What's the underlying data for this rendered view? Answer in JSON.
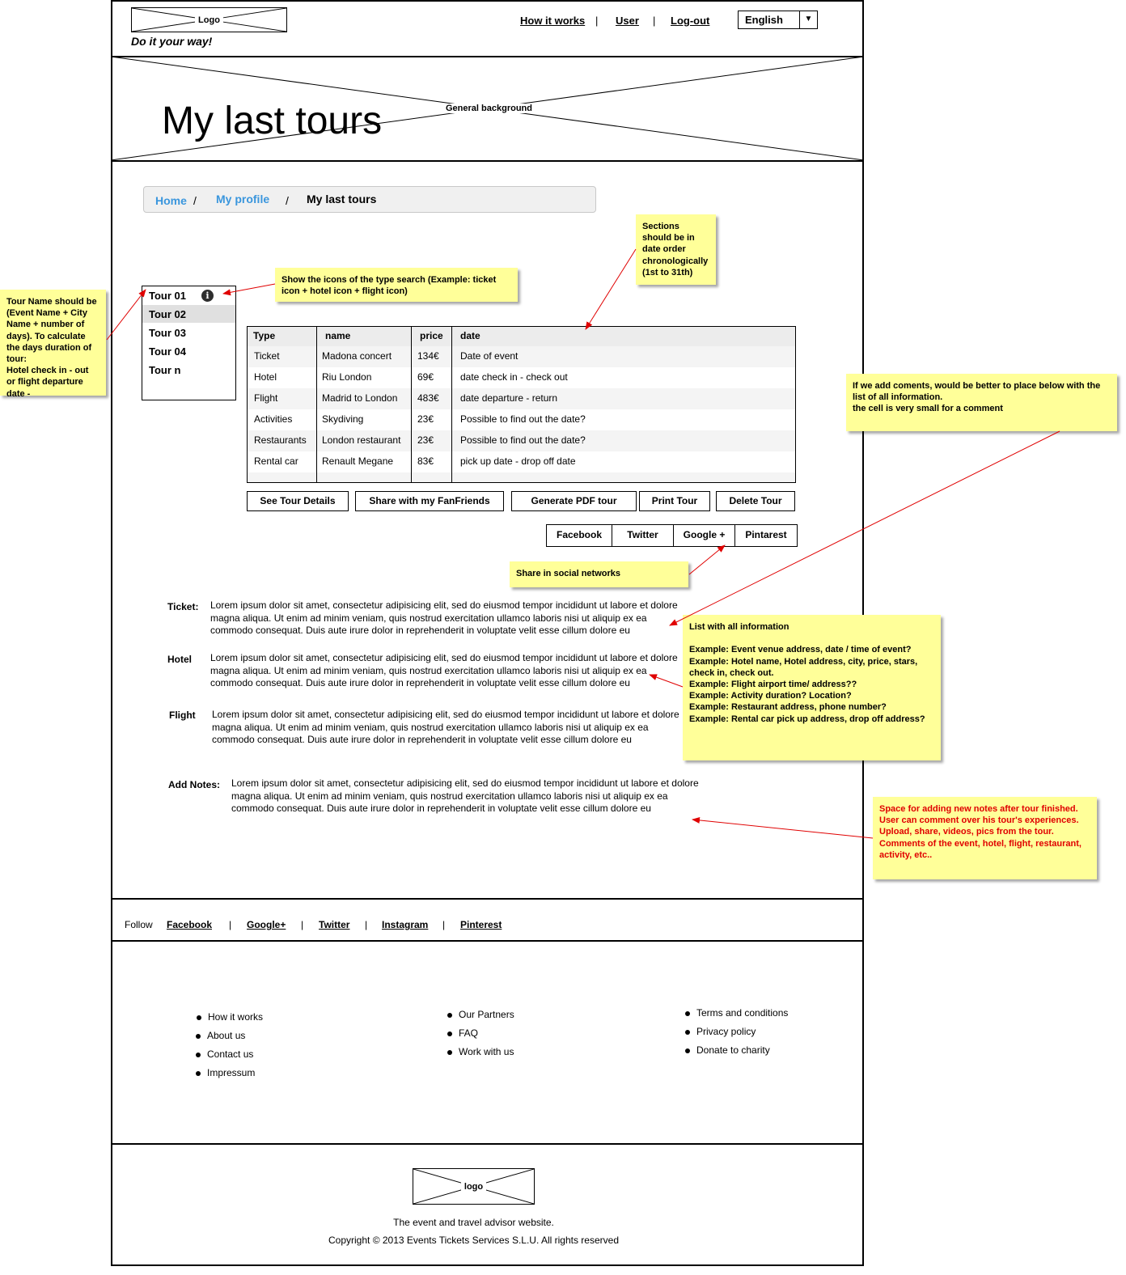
{
  "header": {
    "logo_label": "Logo",
    "tagline": "Do it your way!",
    "nav": [
      "How it works",
      "User",
      "Log-out"
    ],
    "nav_sep": "|",
    "language": "English"
  },
  "hero": {
    "title": "My last tours",
    "background_label": "General background"
  },
  "breadcrumb": {
    "home": "Home",
    "profile": "My profile",
    "current": "My last tours",
    "sep": "/"
  },
  "tours": {
    "items": [
      "Tour 01",
      "Tour 02",
      "Tour 03",
      "Tour 04",
      "Tour n"
    ],
    "selected": "Tour 02",
    "info_glyph": "i"
  },
  "table": {
    "headers": [
      "Type",
      "name",
      "price",
      "date"
    ],
    "rows": [
      [
        "Ticket",
        "Madona concert",
        "134€",
        "Date of event"
      ],
      [
        "Hotel",
        "Riu London",
        "69€",
        "date check in - check out"
      ],
      [
        "Flight",
        "Madrid to London",
        "483€",
        "date departure - return"
      ],
      [
        "Activities",
        "Skydiving",
        "23€",
        "Possible to find out the date?"
      ],
      [
        "Restaurants",
        "London restaurant",
        "23€",
        "Possible to find out the date?"
      ],
      [
        "Rental car",
        "Renault Megane",
        "83€",
        "pick up date - drop off date"
      ]
    ]
  },
  "actions": [
    "See Tour Details",
    "Share with my FanFriends",
    "Generate PDF tour",
    "Print Tour",
    "Delete Tour"
  ],
  "social_share": [
    "Facebook",
    "Twitter",
    "Google +",
    "Pintarest"
  ],
  "details": [
    {
      "label": "Ticket:",
      "text": "Lorem ipsum dolor sit amet, consectetur adipisicing elit, sed do eiusmod tempor incididunt ut labore et dolore magna aliqua. Ut enim ad minim veniam, quis nostrud exercitation ullamco laboris nisi ut aliquip ex ea commodo consequat. Duis aute irure dolor in reprehenderit in voluptate velit esse cillum dolore eu"
    },
    {
      "label": "Hotel",
      "text": "Lorem ipsum dolor sit amet, consectetur adipisicing elit, sed do eiusmod tempor incididunt ut labore et dolore magna aliqua. Ut enim ad minim veniam, quis nostrud exercitation ullamco laboris nisi ut aliquip ex ea commodo consequat. Duis aute irure dolor in reprehenderit in voluptate velit esse cillum dolore eu"
    },
    {
      "label": "Flight",
      "text": "Lorem ipsum dolor sit amet, consectetur adipisicing elit, sed do eiusmod tempor incididunt ut labore et dolore magna aliqua. Ut enim ad minim veniam, quis nostrud exercitation ullamco laboris nisi ut aliquip ex ea commodo consequat. Duis aute irure dolor in reprehenderit in voluptate velit esse cillum dolore eu"
    },
    {
      "label": "Add Notes:",
      "text": "Lorem ipsum dolor sit amet, consectetur adipisicing elit, sed do eiusmod tempor incididunt ut labore et dolore magna aliqua. Ut enim ad minim veniam, quis nostrud exercitation ullamco laboris nisi ut aliquip ex ea commodo consequat. Duis aute irure dolor in reprehenderit in voluptate velit esse cillum dolore eu"
    }
  ],
  "annotations": {
    "tour_name": "Tour Name should be (Event Name + City Name + number of days). To calculate the days duration of tour:\nHotel check in - out or flight departure date -",
    "icons": "Show the icons of the type search (Example: ticket icon + hotel icon + flight icon)",
    "sections": "Sections should be in date order chronologically (1st to 31th)",
    "comments": "If we add coments, would be better to place below with the list of all information.\nthe cell is very small for a comment",
    "share": "Share in social networks",
    "list_info": "List with all information\n\nExample: Event venue address, date / time of event?\nExample: Hotel name, Hotel address, city, price, stars, check in, check out.\nExample: Flight airport time/ address??\nExample: Activity duration? Location?\nExample: Restaurant address, phone number?\nExample: Rental car pick up address, drop off address?",
    "notes_space": "Space for adding new notes after tour finished.\nUser can comment over his tour's experiences.\nUpload, share, videos, pics from the tour.\nComments of the event, hotel, flight, restaurant, activity, etc..",
    "arrow_color": "#e00000",
    "sticky_color": "#ffff99"
  },
  "follow": {
    "label": "Follow",
    "links": [
      "Facebook",
      "Google+",
      "Twitter",
      "Instagram",
      "Pinterest"
    ],
    "sep": "|"
  },
  "footer": {
    "col1": [
      "How it works",
      "About us",
      "Contact us",
      "Impressum"
    ],
    "col2": [
      "Our Partners",
      "FAQ",
      "Work with us"
    ],
    "col3": [
      "Terms and conditions",
      "Privacy policy",
      "Donate to charity"
    ],
    "logo_label": "logo",
    "slogan": "The event and travel advisor website.",
    "copyright": "Copyright © 2013 Events Tickets Services S.L.U. All rights reserved"
  },
  "colors": {
    "link_blue": "#3a96dd",
    "breadcrumb_bg": "#f0f0f0"
  }
}
